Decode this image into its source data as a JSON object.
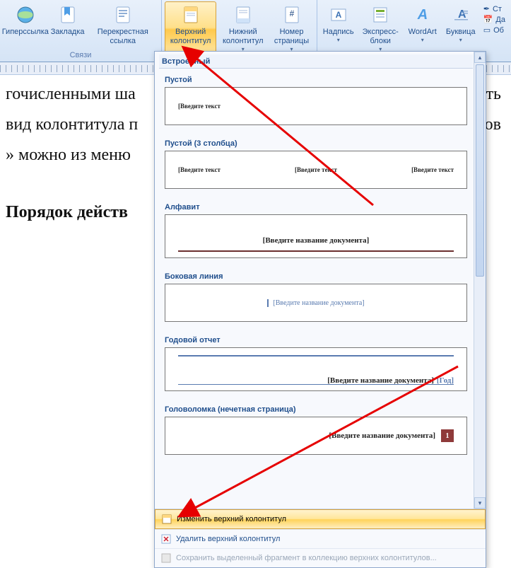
{
  "ribbon": {
    "group_links_label": "Связи",
    "hyperlink": "Гиперссылка",
    "bookmark": "Закладка",
    "crossref": "Перекрестная ссылка",
    "header": "Верхний колонтитул",
    "footer": "Нижний колонтитул",
    "pagenum": "Номер страницы",
    "textbox": "Надпись",
    "quickparts": "Экспресс-блоки",
    "wordart": "WordArt",
    "dropcap": "Буквица",
    "sig": "Ст",
    "date": "Да",
    "obj": "Об"
  },
  "document": {
    "line1": "гочисленными ша",
    "line1_right": "ать",
    "line2": "вид колонтитула п",
    "line2_right": "ов",
    "line3": "» можно из меню",
    "heading": "Порядок действ"
  },
  "gallery": {
    "cat_builtin": "Встроенный",
    "preset_empty": "Пустой",
    "ph_text": "[Введите текст",
    "preset_3col": "Пустой (3 столбца)",
    "preset_alphabet": "Алфавит",
    "ph_doc_title": "[Введите название документа]",
    "preset_sideline": "Боковая линия",
    "preset_annual": "Годовой отчет",
    "year_tag": "[Год]",
    "preset_puzzle": "Головоломка (нечетная страница)",
    "puzzle_num": "1",
    "footer_edit": "Изменить верхний колонтитул",
    "footer_remove": "Удалить верхний колонтитул",
    "footer_save": "Сохранить выделенный фрагмент в коллекцию верхних колонтитулов..."
  }
}
